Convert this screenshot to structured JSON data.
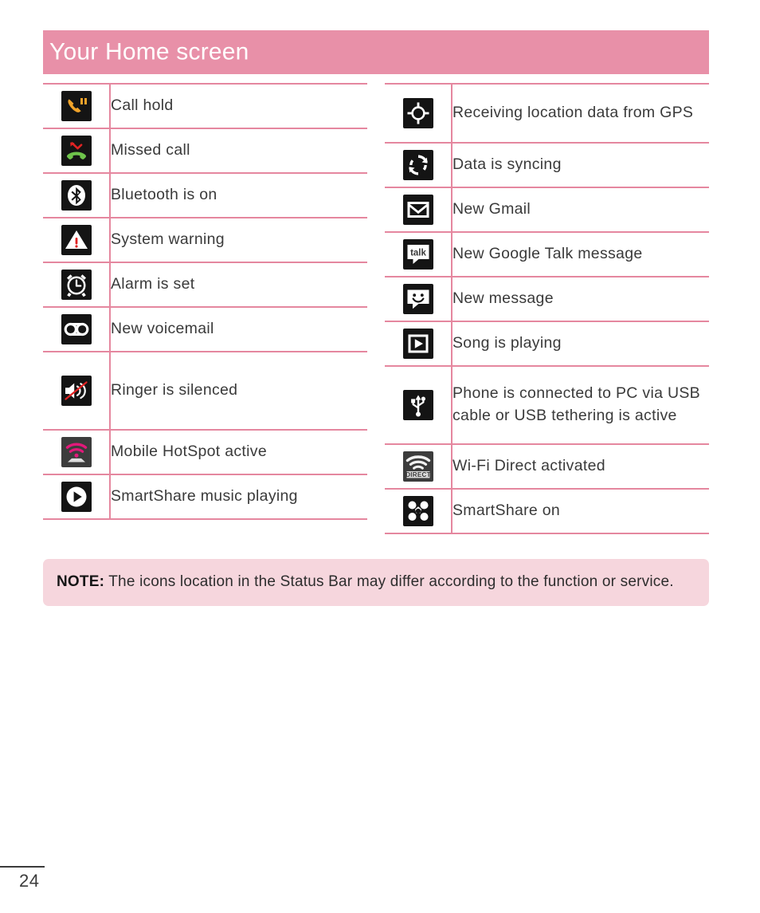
{
  "page": {
    "header_title": "Your Home screen",
    "page_number": "24",
    "accent_color": "#E890A8",
    "rule_color": "#E5879F",
    "note_bg_color": "#F6D6DD",
    "tile_bg_color": "#141414"
  },
  "tables": {
    "left": {
      "rows": [
        {
          "icon": "call-hold-icon",
          "label": "Call hold"
        },
        {
          "icon": "missed-call-icon",
          "label": "Missed call"
        },
        {
          "icon": "bluetooth-icon",
          "label": "Bluetooth is on"
        },
        {
          "icon": "system-warning-icon",
          "label": "System warning"
        },
        {
          "icon": "alarm-clock-icon",
          "label": "Alarm is set"
        },
        {
          "icon": "voicemail-icon",
          "label": "New voicemail"
        },
        {
          "icon": "ringer-silenced-icon",
          "label": "Ringer is silenced"
        },
        {
          "icon": "mobile-hotspot-icon",
          "label": "Mobile HotSpot active"
        },
        {
          "icon": "smartshare-play-icon",
          "label": "SmartShare music playing"
        }
      ]
    },
    "right": {
      "rows": [
        {
          "icon": "gps-location-icon",
          "label": "Receiving location data from GPS"
        },
        {
          "icon": "sync-icon",
          "label": "Data is syncing"
        },
        {
          "icon": "gmail-icon",
          "label": "New Gmail"
        },
        {
          "icon": "google-talk-icon",
          "label": "New Google Talk message"
        },
        {
          "icon": "new-message-icon",
          "label": "New message"
        },
        {
          "icon": "song-playing-icon",
          "label": "Song is playing"
        },
        {
          "icon": "usb-icon",
          "label": "Phone is connected to PC via USB cable or USB tethering is active"
        },
        {
          "icon": "wifi-direct-icon",
          "label": "Wi-Fi Direct activated"
        },
        {
          "icon": "smartshare-on-icon",
          "label": "SmartShare on"
        }
      ]
    }
  },
  "note": {
    "label": "NOTE:",
    "text": "The icons location in the Status Bar may differ according to the function or service."
  }
}
